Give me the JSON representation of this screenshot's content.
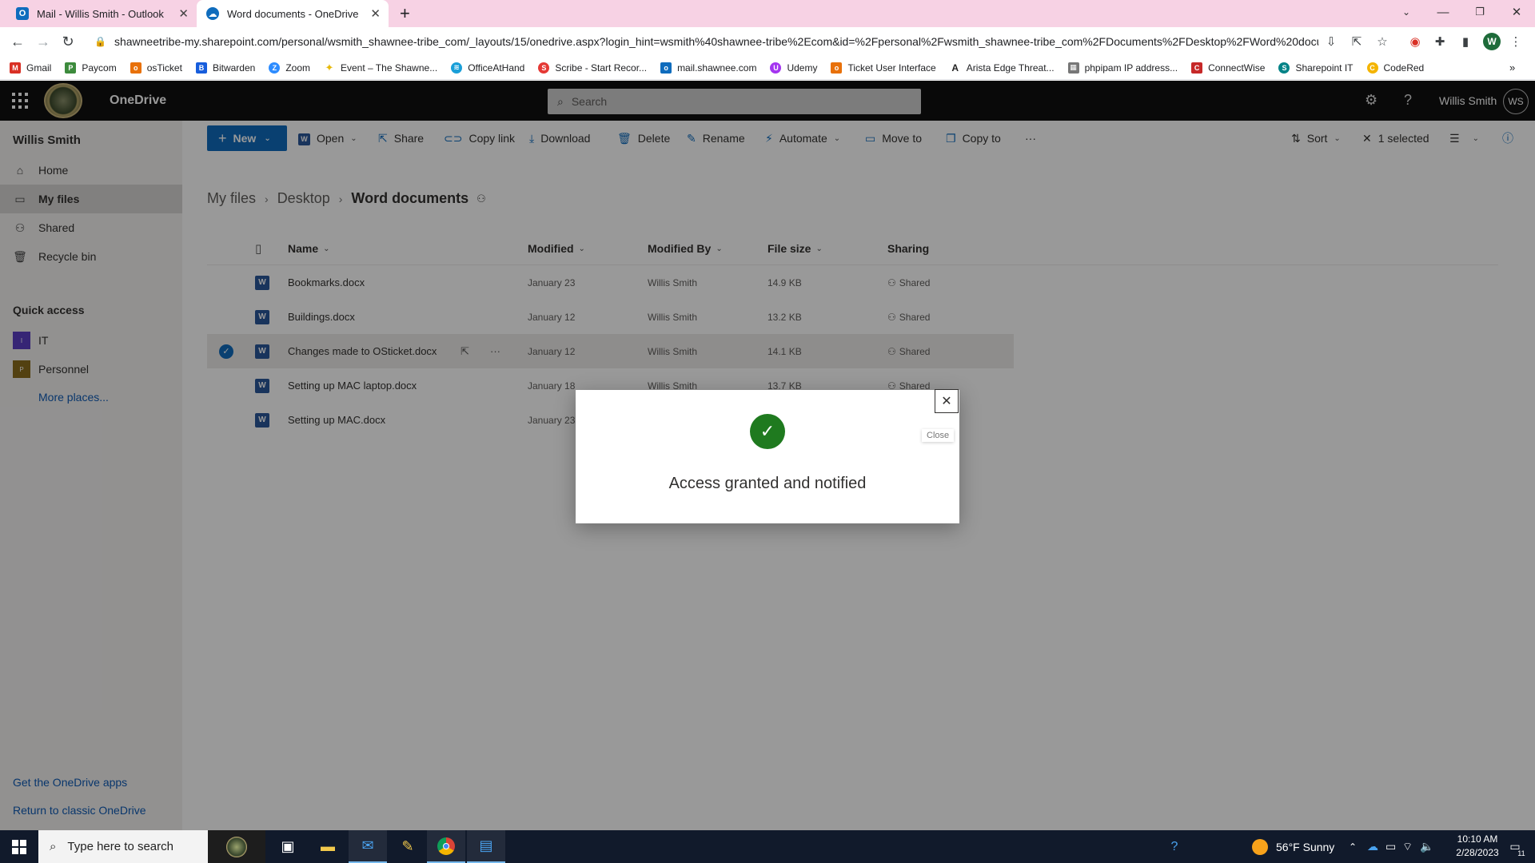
{
  "browser": {
    "tabs": [
      {
        "title": "Mail - Willis Smith - Outlook",
        "icon": "outlook-icon",
        "active": false
      },
      {
        "title": "Word documents - OneDrive",
        "icon": "onedrive-icon",
        "active": true
      }
    ],
    "url": "shawneetribe-my.sharepoint.com/personal/wsmith_shawnee-tribe_com/_layouts/15/onedrive.aspx?login_hint=wsmith%40shawnee-tribe%2Ecom&id=%2Fpersonal%2Fwsmith_shawnee-tribe_com%2FDocuments%2FDesktop%2FWord%20docu...",
    "profile_initial": "W",
    "bookmarks": [
      {
        "label": "Gmail",
        "color": "#d93025",
        "glyph": "M"
      },
      {
        "label": "Paycom",
        "color": "#3d8b3d",
        "glyph": "P"
      },
      {
        "label": "osTicket",
        "color": "#e8710a",
        "glyph": "o"
      },
      {
        "label": "Bitwarden",
        "color": "#175ddc",
        "glyph": "B"
      },
      {
        "label": "Zoom",
        "color": "#2d8cff",
        "glyph": "Z"
      },
      {
        "label": "Event – The Shawne...",
        "color": "#e8b90a",
        "glyph": "✦"
      },
      {
        "label": "OfficeAtHand",
        "color": "#1a9fd8",
        "glyph": "≋"
      },
      {
        "label": "Scribe - Start Recor...",
        "color": "#e53935",
        "glyph": "S"
      },
      {
        "label": "mail.shawnee.com",
        "color": "#0f6cbd",
        "glyph": "o"
      },
      {
        "label": "Udemy",
        "color": "#a435f0",
        "glyph": "U"
      },
      {
        "label": "Ticket User Interface",
        "color": "#e8710a",
        "glyph": "o"
      },
      {
        "label": "Arista Edge Threat...",
        "color": "#222222",
        "glyph": "A"
      },
      {
        "label": "phpipam IP address...",
        "color": "#777777",
        "glyph": "▦"
      },
      {
        "label": "ConnectWise",
        "color": "#c62828",
        "glyph": "C"
      },
      {
        "label": "Sharepoint IT",
        "color": "#038387",
        "glyph": "S"
      },
      {
        "label": "CodeRed",
        "color": "#f4b400",
        "glyph": "C"
      }
    ]
  },
  "suite": {
    "app_name": "OneDrive",
    "search_placeholder": "Search",
    "user_name": "Willis Smith",
    "user_initials": "WS"
  },
  "leftnav": {
    "owner": "Willis Smith",
    "items": [
      {
        "label": "Home",
        "icon": "home-icon"
      },
      {
        "label": "My files",
        "icon": "folder-icon"
      },
      {
        "label": "Shared",
        "icon": "shared-icon"
      },
      {
        "label": "Recycle bin",
        "icon": "recycle-bin-icon"
      }
    ],
    "quick_access_title": "Quick access",
    "quick_access": [
      {
        "label": "IT",
        "color": "#5b3fc4"
      },
      {
        "label": "Personnel",
        "color": "#8a6d1d"
      }
    ],
    "more_places": "More places...",
    "get_apps": "Get the OneDrive apps",
    "return_classic": "Return to classic OneDrive"
  },
  "commands": {
    "new": "New",
    "open": "Open",
    "share": "Share",
    "copy_link": "Copy link",
    "download": "Download",
    "delete": "Delete",
    "rename": "Rename",
    "automate": "Automate",
    "move_to": "Move to",
    "copy_to": "Copy to",
    "more": "···",
    "sort": "Sort",
    "selected": "1 selected"
  },
  "breadcrumb": {
    "items": [
      "My files",
      "Desktop"
    ],
    "current": "Word documents"
  },
  "columns": {
    "name": "Name",
    "modified": "Modified",
    "modified_by": "Modified By",
    "file_size": "File size",
    "sharing": "Sharing"
  },
  "files": [
    {
      "name": "Bookmarks.docx",
      "modified": "January 23",
      "modified_by": "Willis Smith",
      "size": "14.9 KB",
      "sharing": "Shared",
      "selected": false
    },
    {
      "name": "Buildings.docx",
      "modified": "January 12",
      "modified_by": "Willis Smith",
      "size": "13.2 KB",
      "sharing": "Shared",
      "selected": false
    },
    {
      "name": "Changes made to OSticket.docx",
      "modified": "January 12",
      "modified_by": "Willis Smith",
      "size": "14.1 KB",
      "sharing": "Shared",
      "selected": true
    },
    {
      "name": "Setting up MAC laptop.docx",
      "modified": "January 18",
      "modified_by": "Willis Smith",
      "size": "13.7 KB",
      "sharing": "Shared",
      "selected": false
    },
    {
      "name": "Setting up MAC.docx",
      "modified": "January 23",
      "modified_by": "Willis Smith",
      "size": "",
      "sharing": "",
      "selected": false
    }
  ],
  "dialog": {
    "message": "Access granted and notified",
    "close_tooltip": "Close"
  },
  "taskbar": {
    "search_placeholder": "Type here to search",
    "weather": "56°F  Sunny",
    "time": "10:10 AM",
    "date": "2/28/2023",
    "notification_count": "11"
  }
}
